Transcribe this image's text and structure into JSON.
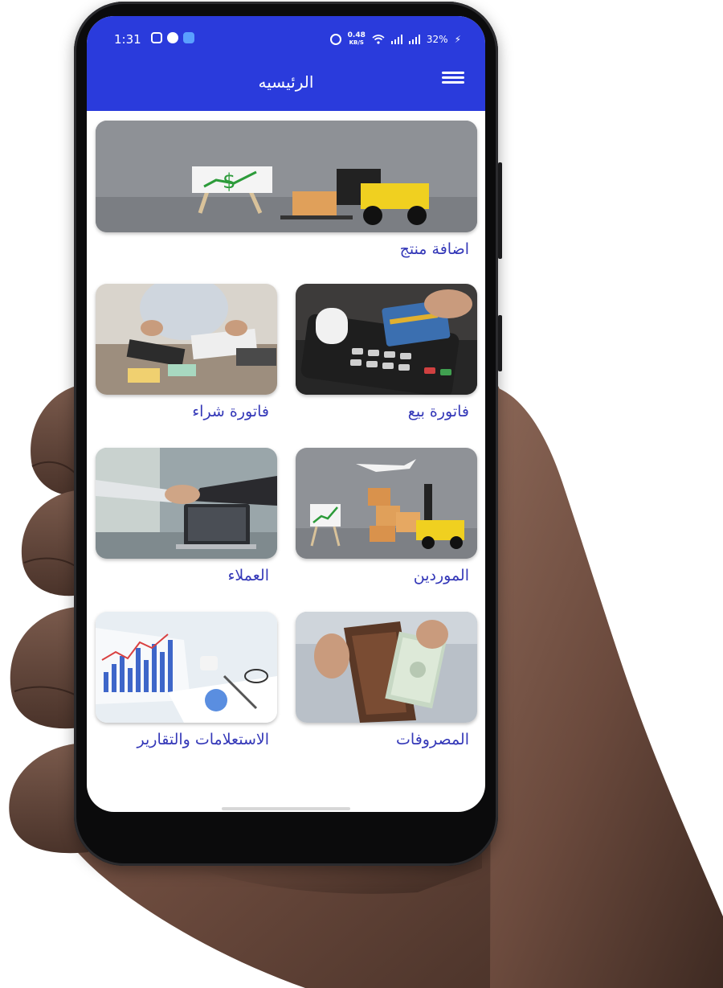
{
  "status_bar": {
    "time": "1:31",
    "net_speed_value": "0.48",
    "net_speed_unit": "KB/S",
    "battery": "32%"
  },
  "app_bar": {
    "title": "الرئيسيه",
    "color": "#2a3bdc"
  },
  "menu": {
    "add_product": "اضافة منتج",
    "sales_invoice": "فاتورة بيع",
    "purchase_invoice": "فاتورة شراء",
    "suppliers": "الموردين",
    "customers": "العملاء",
    "expenses": "المصروفات",
    "reports": "الاستعلامات والتقارير"
  },
  "colors": {
    "label": "#3438b8"
  }
}
